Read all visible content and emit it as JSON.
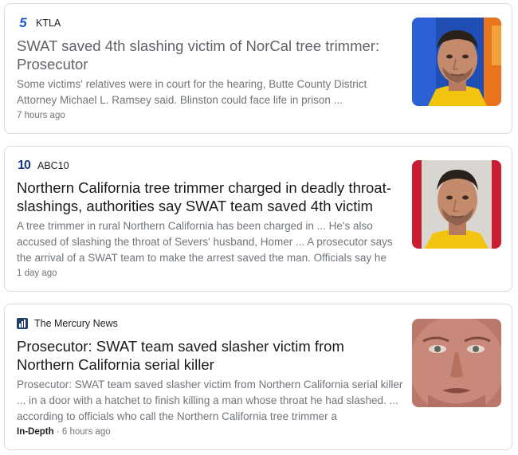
{
  "articles": [
    {
      "source": "KTLA",
      "logo_text": "5",
      "headline": "SWAT saved 4th slashing victim of NorCal tree trimmer: Prosecutor",
      "snippet": "Some victims' relatives were in court for the hearing, Butte County District Attorney Michael L. Ramsey said. Blinston could face life in prison ...",
      "time": "7 hours ago"
    },
    {
      "source": "ABC10",
      "logo_text": "10",
      "headline": "Northern California tree trimmer charged in deadly throat-slashings, authorities say SWAT team saved 4th victim",
      "snippet": "A tree trimmer in rural Northern California has been charged in ... He's also accused of slashing the throat of Severs' husband, Homer ... A prosecutor says the arrival of a SWAT team to make the arrest saved the man. Officials say he",
      "time": "1 day ago"
    },
    {
      "source": "The Mercury News",
      "headline": "Prosecutor: SWAT team saved slasher victim from Northern California serial killer",
      "snippet": "Prosecutor: SWAT team saved slasher victim from Northern California serial killer ... in a door with a hatchet to finish killing a man whose throat he had slashed. ... according to officials who call the Northern California tree trimmer a",
      "label": "In-Depth",
      "separator": " · ",
      "time": "6 hours ago"
    }
  ],
  "colors": {
    "headline_visited": "#5f6368",
    "headline": "#1a1a1a",
    "snippet": "#70757a",
    "border": "#dadce0",
    "ktla_blue": "#1a57c9",
    "abc10_navy": "#1a3a8a",
    "mercury_navy": "#1f3f6e"
  }
}
